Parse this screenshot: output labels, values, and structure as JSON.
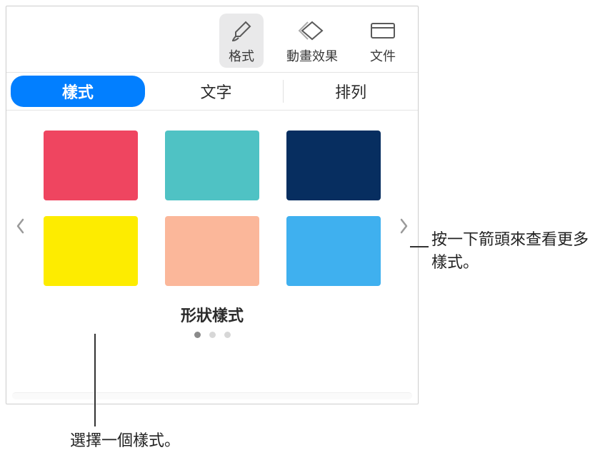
{
  "toolbar": {
    "format": "格式",
    "animate": "動畫效果",
    "document": "文件"
  },
  "tabs": {
    "style": "樣式",
    "text": "文字",
    "arrange": "排列"
  },
  "swatches": {
    "title": "形狀樣式",
    "colors": [
      "#ef4560",
      "#4fc2c4",
      "#072e60",
      "#fdec00",
      "#fbb79a",
      "#3fb0ef"
    ]
  },
  "pager": {
    "count": 3,
    "active": 0
  },
  "callouts": {
    "arrow_hint": "按一下箭頭來查看更多樣式。",
    "select_hint": "選擇一個樣式。"
  }
}
